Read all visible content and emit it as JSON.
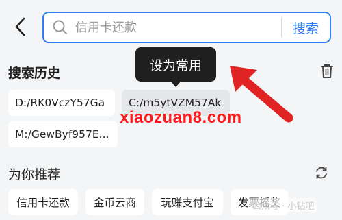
{
  "search": {
    "placeholder": "信用卡还款",
    "button_label": "搜索"
  },
  "tooltip": {
    "label": "设为常用"
  },
  "history": {
    "title": "搜索历史",
    "items": [
      "D:/RK0VczY57Ga",
      "C:/m5ytVZM57Ak",
      "M:/GewByf957E..."
    ]
  },
  "recommend": {
    "title": "为你推荐",
    "items": [
      "信用卡还款",
      "金币云商",
      "玩赚支付宝",
      "发票摇奖"
    ]
  },
  "overlay": {
    "watermark": "xiaozuan8.com",
    "credit": "公众号 · 小钻吧",
    "arrow_color": "#e02424"
  },
  "colors": {
    "accent": "#2f7df6",
    "background": "#f4f5f7"
  }
}
